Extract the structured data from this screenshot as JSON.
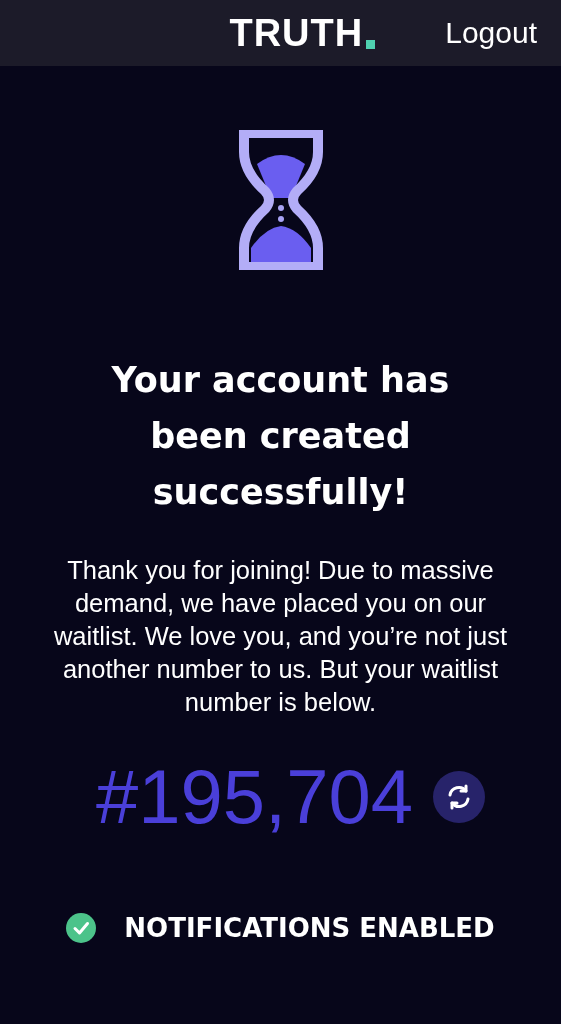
{
  "header": {
    "logo": "TRUTH",
    "logout": "Logout"
  },
  "title": "Your account has been created successfully!",
  "message": "Thank you for joining! Due to massive demand, we have placed you on our waitlist. We love you, and you’re not just another number to us. But your waitlist number is below.",
  "waitlist_number": "#195,704",
  "notifications": {
    "label": "NOTIFICATIONS ENABLED",
    "on": true
  }
}
